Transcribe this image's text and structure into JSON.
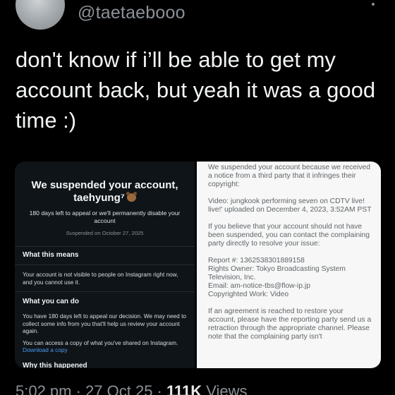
{
  "author": {
    "handle": "@taetaebooo"
  },
  "tweet": {
    "text": "don't know if i’ll be able to get my account back, but yeah it was a good time :)"
  },
  "ig_notice": {
    "title": "We suspended your account, taehyung⁷",
    "days_left": "180 days left to appeal or we'll permanently disable your account",
    "suspended_on": "Suspended on October 27, 2025",
    "h_means": "What this means",
    "p_means": "Your account is not visible to people on Instagram right now, and you cannot use it.",
    "h_can_do": "What you can do",
    "p_can_do_1": "You have 180 days left to appeal our decision. We may need to collect some info from you that'll help us review your account again.",
    "p_can_do_2": "You can access a copy of what you've shared on Instagram.",
    "download_link": "Download a copy",
    "h_why": "Why this happened"
  },
  "email_notice": {
    "p1": "We suspended your account because we received a notice from a third party that it infringes their copyright:",
    "p2": "Video: jungkook performing seven on CDTV live! live!' uploaded on December 4, 2023, 3:52AM PST",
    "p3": "If you believe that your account should not have been suspended, you can contact the complaining party directly to resolve your issue:",
    "report": "Report #: 1362538301889158",
    "owner": "Rights Owner: Tokyo Broadcasting System Television, Inc.",
    "email_label": "Email: ",
    "email": "am-notice-tbs@flow-ip.jp",
    "work": "Copyrighted Work: Video",
    "p4": "If an agreement is reached to restore your account, please have the reporting party send us a retraction through the appropriate channel. Please note that the complaining party isn't"
  },
  "footer": {
    "time": "5:02 pm · 27 Oct 25 · ",
    "views_count": "111K",
    "views_label": " Views"
  },
  "colors": {
    "background": "#000000",
    "text": "#e7e9ea",
    "muted": "#8b9197",
    "link": "#1f4fd8"
  }
}
